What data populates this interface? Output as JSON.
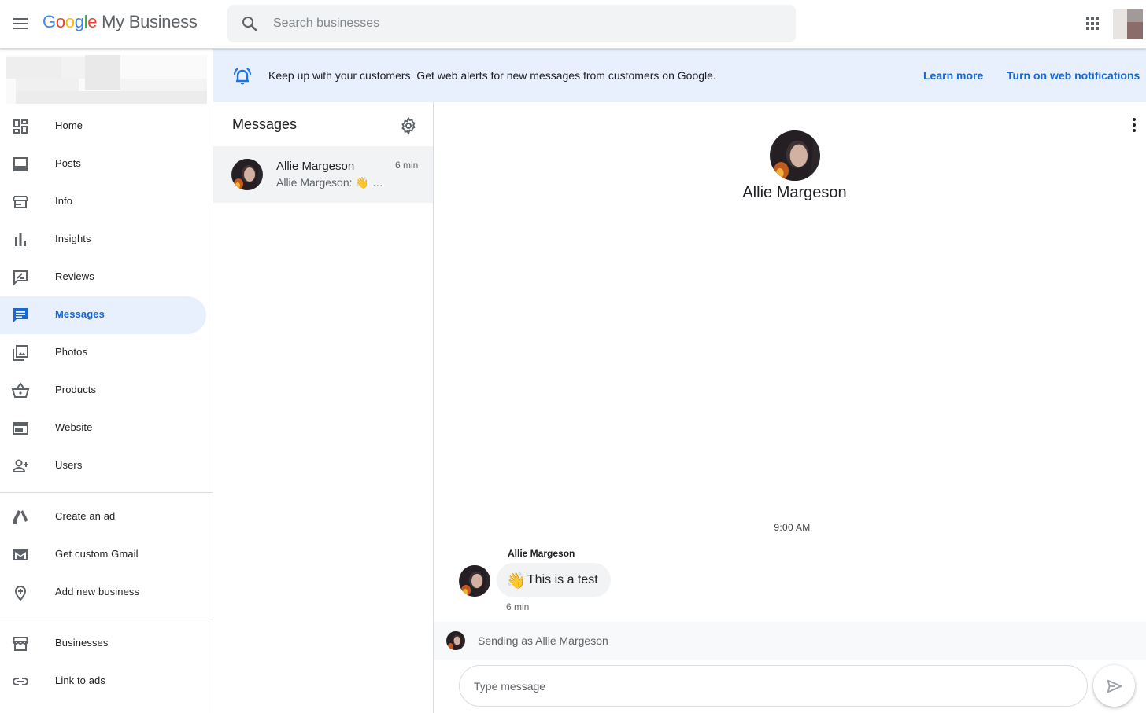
{
  "app": {
    "logo_letters": [
      "G",
      "o",
      "o",
      "g",
      "l",
      "e"
    ],
    "product_name": "My Business"
  },
  "search": {
    "placeholder": "Search businesses"
  },
  "colors": {
    "accent": "#1967d2",
    "banner_bg": "#e8f0fe",
    "active_nav_bg": "#e8f0fe"
  },
  "sidebar": {
    "items": [
      {
        "label": "Home",
        "icon": "dashboard-icon"
      },
      {
        "label": "Posts",
        "icon": "posts-icon"
      },
      {
        "label": "Info",
        "icon": "storefront-icon"
      },
      {
        "label": "Insights",
        "icon": "bar-chart-icon"
      },
      {
        "label": "Reviews",
        "icon": "rate-review-icon"
      },
      {
        "label": "Messages",
        "icon": "chat-icon",
        "active": true
      },
      {
        "label": "Photos",
        "icon": "photo-library-icon"
      },
      {
        "label": "Products",
        "icon": "shopping-basket-icon"
      },
      {
        "label": "Website",
        "icon": "web-icon"
      },
      {
        "label": "Users",
        "icon": "person-add-icon"
      }
    ],
    "secondary": [
      {
        "label": "Create an ad",
        "icon": "google-ads-icon"
      },
      {
        "label": "Get custom Gmail",
        "icon": "gmail-icon"
      },
      {
        "label": "Add new business",
        "icon": "add-location-icon"
      }
    ],
    "tertiary": [
      {
        "label": "Businesses",
        "icon": "store-icon"
      },
      {
        "label": "Link to ads",
        "icon": "link-icon"
      }
    ]
  },
  "banner": {
    "text": "Keep up with your customers. Get web alerts for new messages from customers on Google.",
    "learn_more": "Learn more",
    "turn_on": "Turn on web notifications"
  },
  "messages_list": {
    "title": "Messages",
    "conversations": [
      {
        "name": "Allie Margeson",
        "time": "6 min",
        "preview": "Allie Margeson: 👋 …"
      }
    ]
  },
  "chat": {
    "contact_name": "Allie Margeson",
    "day_time": "9:00 AM",
    "messages": [
      {
        "sender": "Allie Margeson",
        "emoji": "👋",
        "text": "This is a test",
        "time": "6 min"
      }
    ],
    "sending_as": "Sending as Allie Margeson",
    "composer_placeholder": "Type message"
  }
}
